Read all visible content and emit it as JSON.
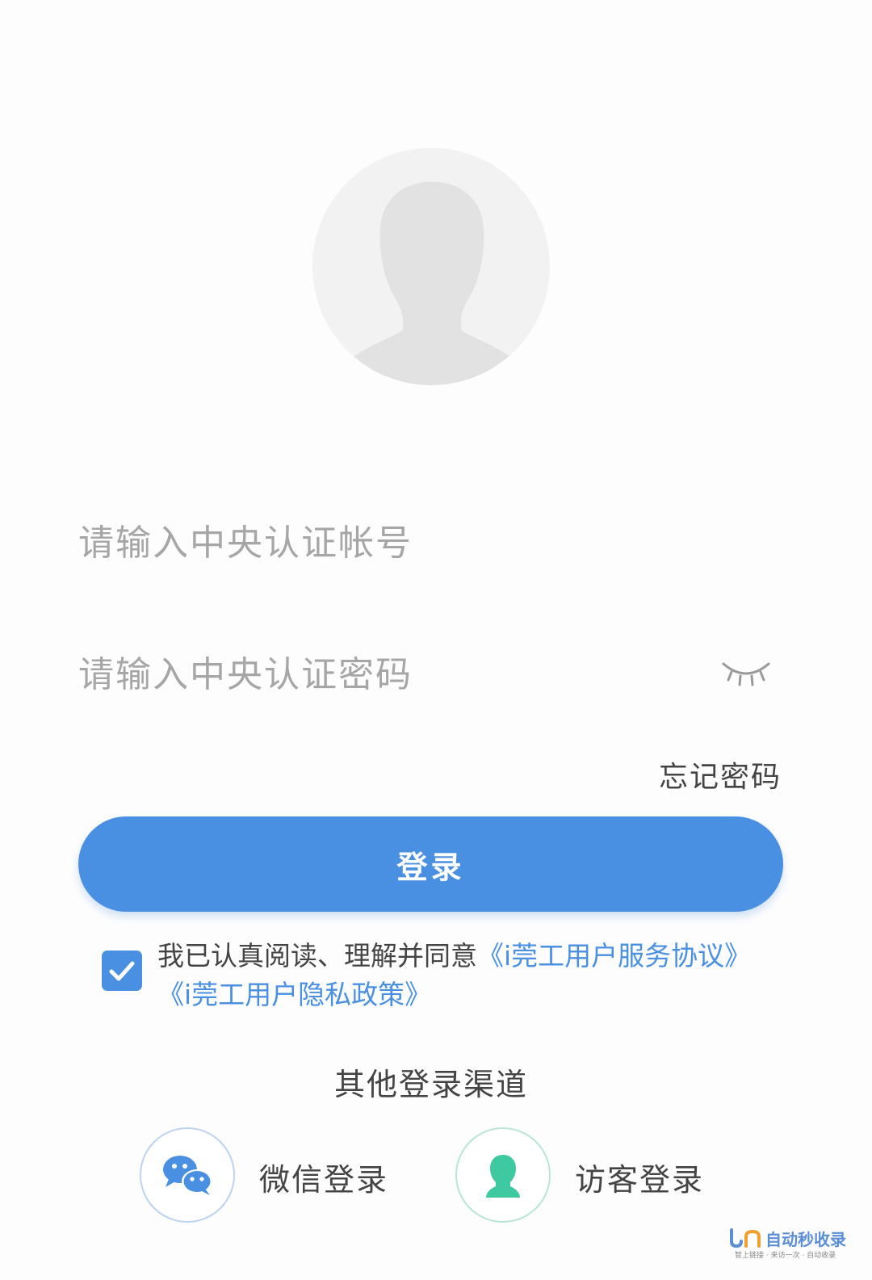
{
  "login": {
    "account_placeholder": "请输入中央认证帐号",
    "password_placeholder": "请输入中央认证密码",
    "forgot_password": "忘记密码",
    "submit_label": "登录"
  },
  "agreement": {
    "checked": true,
    "text": "我已认真阅读、理解并同意",
    "service_link": "《i莞工用户服务协议》",
    "privacy_link": "《i莞工用户隐私政策》"
  },
  "other_login": {
    "title": "其他登录渠道",
    "wechat_label": "微信登录",
    "guest_label": "访客登录"
  },
  "icons": {
    "avatar": "user-silhouette-icon",
    "password_visibility": "eye-closed-icon",
    "checkbox": "checkmark-icon",
    "wechat": "wechat-icon",
    "guest": "guest-user-icon"
  },
  "colors": {
    "accent": "#4a90e2",
    "guest_icon": "#3ec9a0",
    "placeholder": "#a6a6a6"
  },
  "watermark": {
    "text": "自动秒收录",
    "subtext": "智上链接 · 来访一次 · 自动收录"
  }
}
